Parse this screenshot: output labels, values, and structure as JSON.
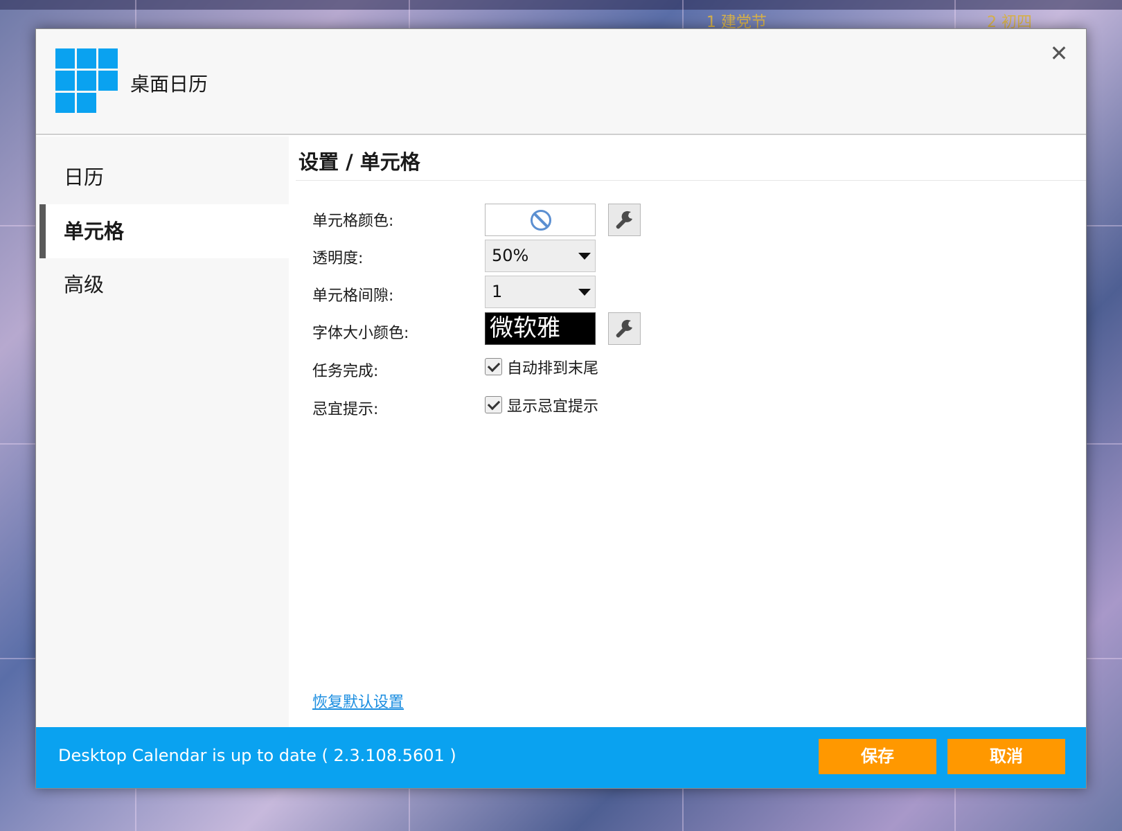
{
  "background": {
    "cell_labels": [
      "1  建党节",
      "2  初四"
    ]
  },
  "window": {
    "app_title": "桌面日历",
    "close_glyph": "✕"
  },
  "sidebar": {
    "items": [
      {
        "label": "日历",
        "active": false
      },
      {
        "label": "单元格",
        "active": true
      },
      {
        "label": "高级",
        "active": false
      }
    ]
  },
  "main": {
    "section_title": "设置 / 单元格",
    "rows": {
      "cell_color_label": "单元格颜色:",
      "opacity_label": "透明度:",
      "opacity_value": "50%",
      "gap_label": "单元格间隙:",
      "gap_value": "1",
      "font_label": "字体大小颜色:",
      "font_preview": "微软雅",
      "task_label": "任务完成:",
      "task_check_label": "自动排到末尾",
      "task_checked": true,
      "yiji_label": "忌宜提示:",
      "yiji_check_label": "显示忌宜提示",
      "yiji_checked": true
    },
    "restore_link": "恢复默认设置"
  },
  "footer": {
    "status": "Desktop Calendar is up to date ( 2.3.108.5601 )",
    "save_label": "保存",
    "cancel_label": "取消"
  },
  "colors": {
    "accent": "#0aa2f0",
    "button": "#ff9800",
    "link": "#1a8de0"
  },
  "icons": [
    "app-logo-icon",
    "close-icon",
    "no-color-icon",
    "wrench-icon",
    "dropdown-arrow-icon",
    "checkmark-icon"
  ]
}
